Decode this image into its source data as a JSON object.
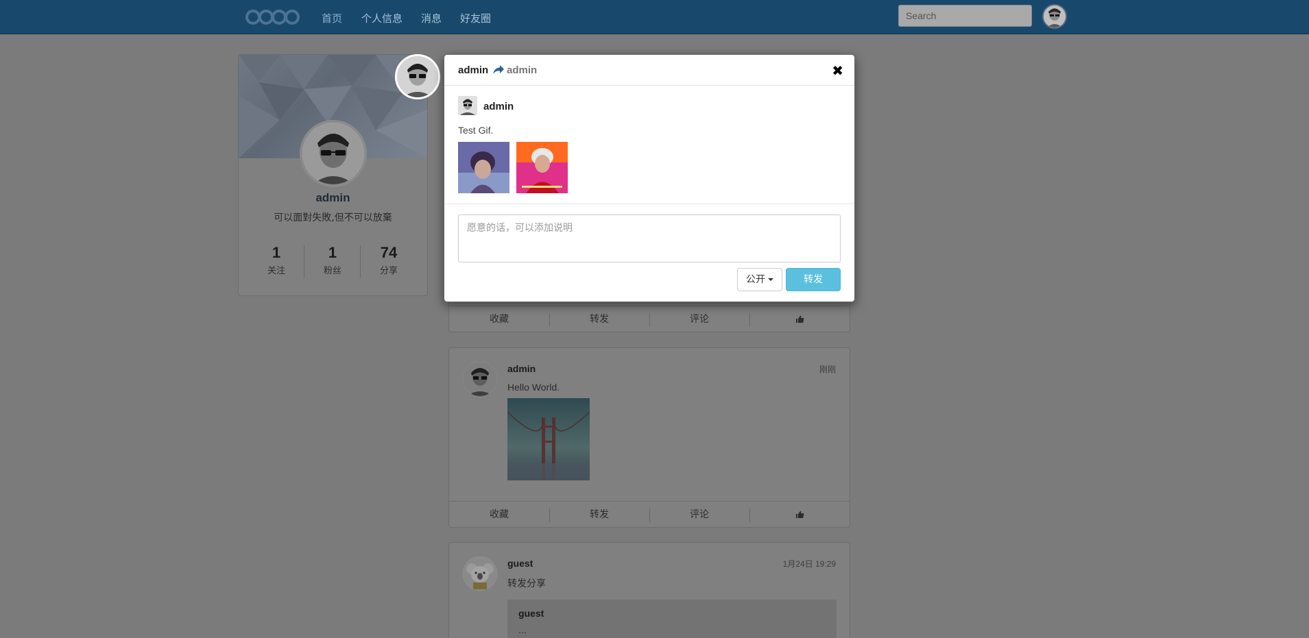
{
  "nav": {
    "links": [
      "首页",
      "个人信息",
      "消息",
      "好友圈"
    ],
    "search_placeholder": "Search"
  },
  "profile": {
    "name": "admin",
    "motto": "可以面對失敗,但不可以放棄",
    "stats": [
      {
        "value": "1",
        "label": "关注"
      },
      {
        "value": "1",
        "label": "粉丝"
      },
      {
        "value": "74",
        "label": "分享"
      }
    ]
  },
  "actions": {
    "favorite": "收藏",
    "repost": "转发",
    "comment": "评论",
    "like_icon": "thumbs-up-icon"
  },
  "feed": [
    {
      "author": "admin",
      "time": "刚刚",
      "text": "Hello World."
    },
    {
      "author": "guest",
      "time": "1月24日 19:29",
      "text": "转发分享",
      "quoted_author": "guest",
      "quoted_text": "..."
    }
  ],
  "modal": {
    "title_user": "admin",
    "title_target": "admin",
    "original_author": "admin",
    "original_text": "Test Gif.",
    "comment_placeholder": "愿意的话，可以添加说明",
    "visibility": "公开",
    "submit": "转发",
    "close_icon": "close-icon"
  },
  "colors": {
    "navbar": "#18496d",
    "submit": "#5bc0de",
    "overlay": "#7b7b7b"
  }
}
